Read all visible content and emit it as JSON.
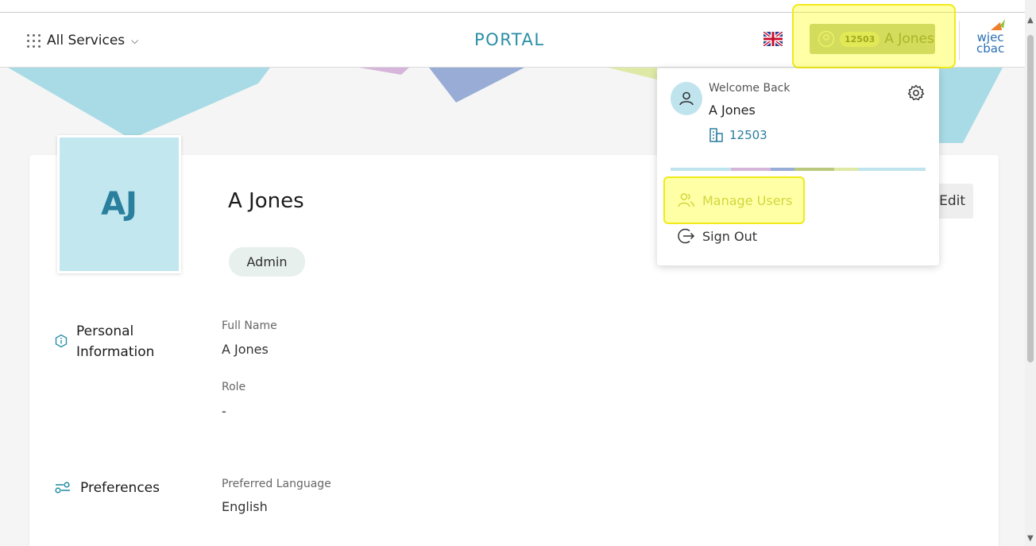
{
  "header": {
    "all_services": "All Services",
    "portal_title": "PORTAL",
    "user_pill": {
      "number": "12503",
      "name": "A Jones"
    },
    "logo_line1": "wjec",
    "logo_line2": "cbac"
  },
  "profile": {
    "initials": "AJ",
    "name": "A Jones",
    "role_badge": "Admin",
    "edit_label": "Edit"
  },
  "sections": {
    "personal": {
      "title_line1": "Personal",
      "title_line2": "Information",
      "full_name_label": "Full Name",
      "full_name_value": "A Jones",
      "role_label": "Role",
      "role_value": "-"
    },
    "preferences": {
      "title": "Preferences",
      "language_label": "Preferred Language",
      "language_value": "English"
    }
  },
  "dropdown": {
    "welcome": "Welcome Back",
    "name": "A Jones",
    "number": "12503",
    "manage_users": "Manage Users",
    "sign_out": "Sign Out"
  },
  "colors": {
    "accent": "#2a8fa6",
    "pill_bg": "#bdc98f",
    "avatar_bg": "#c2e7ee",
    "highlight": "#f0ea1a"
  }
}
